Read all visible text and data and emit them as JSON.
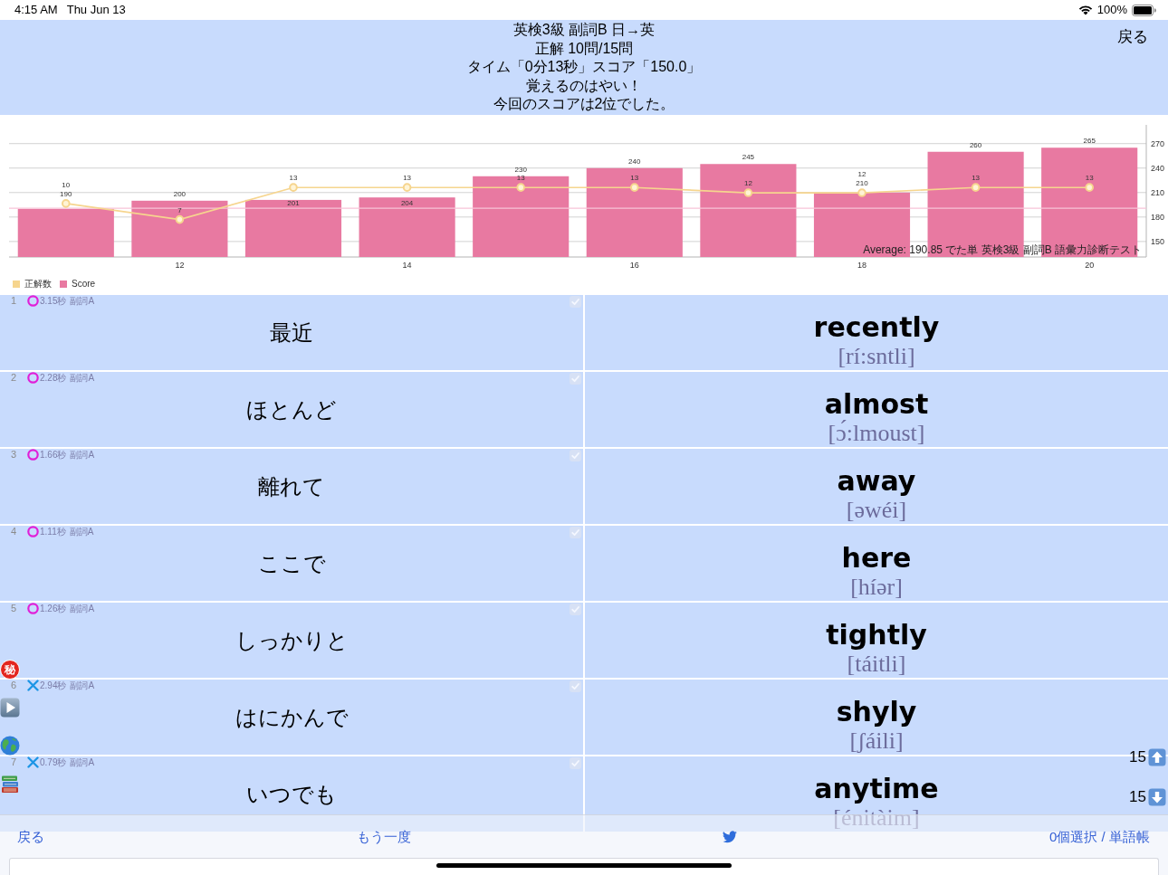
{
  "status_bar": {
    "time": "4:15 AM",
    "date": "Thu Jun 13",
    "battery": "100%"
  },
  "header": {
    "lines": [
      "英検3級 副詞B 日→英",
      "正解 10問/15問",
      "タイム「0分13秒」スコア「150.0」",
      "覚えるのはやい！",
      "今回のスコアは2位でした。"
    ],
    "back_button": "戻る"
  },
  "chart": {
    "chart_data": [
      {
        "type": "bar",
        "categories": [
          null,
          "12",
          null,
          "14",
          null,
          "16",
          null,
          "18",
          null,
          "20"
        ],
        "series": [
          {
            "name": "正解数",
            "type": "line",
            "axis": "y2",
            "marker": "circle",
            "color": "#f6d58e",
            "values": [
              10,
              7,
              13,
              13,
              13,
              13,
              12,
              12,
              13,
              13
            ]
          },
          {
            "name": "Score",
            "type": "bar",
            "color": "#e879a1",
            "values": [
              190,
              200,
              201,
              204,
              230,
              240,
              245,
              210,
              260,
              265
            ]
          }
        ],
        "ylim": [
          131,
          293
        ],
        "yticks": [
          150,
          180,
          210,
          240,
          270
        ],
        "grid": true,
        "data_labels": true,
        "legend": "bottom-left",
        "ref_lines": [
          {
            "axis": "y",
            "value": 190.85,
            "color": "#f7c3d7"
          }
        ],
        "annotations": [
          "Average: 190.85 でた単 英検3級 副詞B 語彙力診断テスト"
        ]
      }
    ]
  },
  "rows": [
    {
      "index": "1",
      "correct": true,
      "time": "3.15秒",
      "tag": "副詞A",
      "checked": true,
      "japanese": "最近",
      "english": "recently",
      "reading": "[rí:sntli]"
    },
    {
      "index": "2",
      "correct": true,
      "time": "2.28秒",
      "tag": "副詞A",
      "checked": true,
      "japanese": "ほとんど",
      "english": "almost",
      "reading": "[ɔ́:lmoust]"
    },
    {
      "index": "3",
      "correct": true,
      "time": "1.66秒",
      "tag": "副詞A",
      "checked": true,
      "japanese": "離れて",
      "english": "away",
      "reading": "[əwéi]"
    },
    {
      "index": "4",
      "correct": true,
      "time": "1.11秒",
      "tag": "副詞A",
      "checked": true,
      "japanese": "ここで",
      "english": "here",
      "reading": "[híər]"
    },
    {
      "index": "5",
      "correct": true,
      "time": "1.26秒",
      "tag": "副詞A",
      "checked": true,
      "japanese": "しっかりと",
      "english": "tightly",
      "reading": "[táitli]"
    },
    {
      "index": "6",
      "correct": false,
      "time": "2.94秒",
      "tag": "副詞A",
      "checked": true,
      "japanese": "はにかんで",
      "english": "shyly",
      "reading": "[ʃáili]"
    },
    {
      "index": "7",
      "correct": false,
      "time": "0.79秒",
      "tag": "副詞A",
      "checked": true,
      "japanese": "いつでも",
      "english": "anytime",
      "reading": "[énitàim]"
    }
  ],
  "side_buttons": [
    {
      "kind": "secret",
      "label": "秘"
    },
    {
      "kind": "play"
    },
    {
      "kind": "globe"
    },
    {
      "kind": "books"
    }
  ],
  "counters": [
    {
      "kind": "up",
      "count": "15"
    },
    {
      "kind": "down",
      "count": "15"
    }
  ],
  "toolbar": [
    {
      "kind": "button",
      "label": "戻る"
    },
    {
      "kind": "button",
      "label": "もう一度"
    },
    {
      "kind": "share"
    },
    {
      "kind": "button",
      "label": "0個選択 / 単語帳"
    }
  ]
}
